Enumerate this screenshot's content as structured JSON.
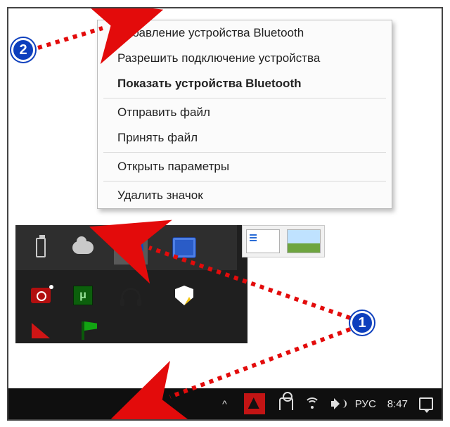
{
  "context_menu": {
    "add_device": "Добавление устройства Bluetooth",
    "allow_connect": "Разрешить подключение устройства",
    "show_devices": "Показать устройства Bluetooth",
    "send_file": "Отправить файл",
    "receive_file": "Принять файл",
    "open_settings": "Открыть параметры",
    "remove_icon": "Удалить значок"
  },
  "tray_icons": {
    "usb": "usb-icon",
    "onedrive": "onedrive-icon",
    "bluetooth": "bluetooth-icon",
    "intel_graphics": "intel-graphics-icon",
    "bandicam": "bandicam-icon",
    "utorrent": "utorrent-icon",
    "utorrent_label": "μ",
    "headphones": "headphones-icon",
    "defender": "windows-defender-icon",
    "antivirus": "antivirus-icon",
    "flag": "flag-icon"
  },
  "taskbar": {
    "chevron": "^",
    "language": "РУС",
    "clock": "8:47"
  },
  "annotations": {
    "badge1": "1",
    "badge2": "2"
  },
  "colors": {
    "bluetooth_blue": "#0a4ec2",
    "badge_blue": "#0d3fbd",
    "arrow_red": "#e30b0b"
  }
}
